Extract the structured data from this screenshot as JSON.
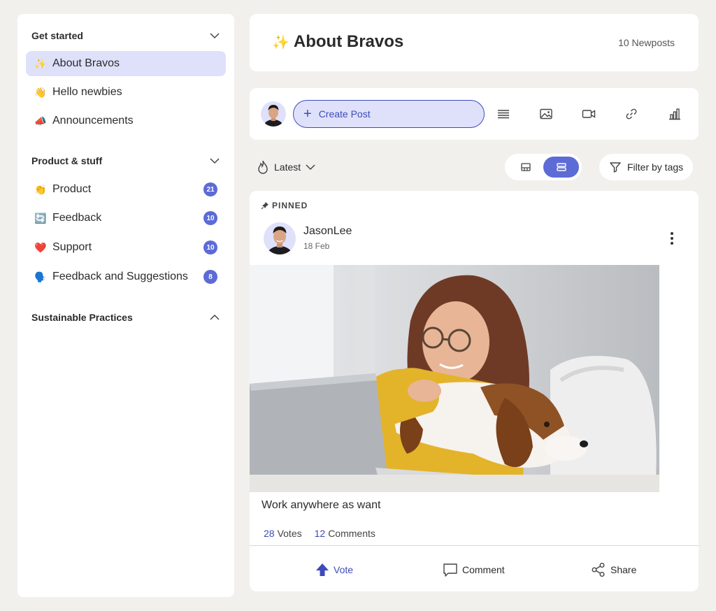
{
  "sidebar": {
    "sections": [
      {
        "title": "Get started",
        "expanded": true
      },
      {
        "title": "Product & stuff",
        "expanded": true
      },
      {
        "title": "Sustainable Practices",
        "expanded": false
      }
    ],
    "items": [
      {
        "emoji": "✨",
        "label": "About Bravos",
        "active": true
      },
      {
        "emoji": "👋",
        "label": "Hello newbies"
      },
      {
        "emoji": "📣",
        "label": "Announcements"
      },
      {
        "emoji": "👏",
        "label": "Product",
        "count": "21"
      },
      {
        "emoji": "🔄",
        "label": "Feedback",
        "count": "10"
      },
      {
        "emoji": "❤️",
        "label": "Support",
        "count": "10"
      },
      {
        "emoji": "🗣️",
        "label": "Feedback and Suggestions",
        "count": "8"
      }
    ]
  },
  "header": {
    "emoji": "✨",
    "title": "About Bravos",
    "newposts": "10 Newposts"
  },
  "composer": {
    "create_post_label": "Create Post",
    "tools": [
      "text-lines-icon",
      "image-icon",
      "video-icon",
      "link-icon",
      "poll-chart-icon"
    ]
  },
  "toolbar": {
    "sort_label": "Latest",
    "filter_label": "Filter by tags"
  },
  "post": {
    "pinned_label": "PINNED",
    "author": "JasonLee",
    "date": "18 Feb",
    "caption": "Work anywhere as want",
    "votes_count": "28",
    "votes_label": "Votes",
    "comments_count": "12",
    "comments_label": "Comments",
    "actions": {
      "vote": "Vote",
      "comment": "Comment",
      "share": "Share"
    }
  },
  "colors": {
    "accent": "#5c6bd6",
    "accent_dark": "#3d4bb8",
    "accent_light": "#dfe1fb",
    "page_bg": "#f1f0ed"
  }
}
